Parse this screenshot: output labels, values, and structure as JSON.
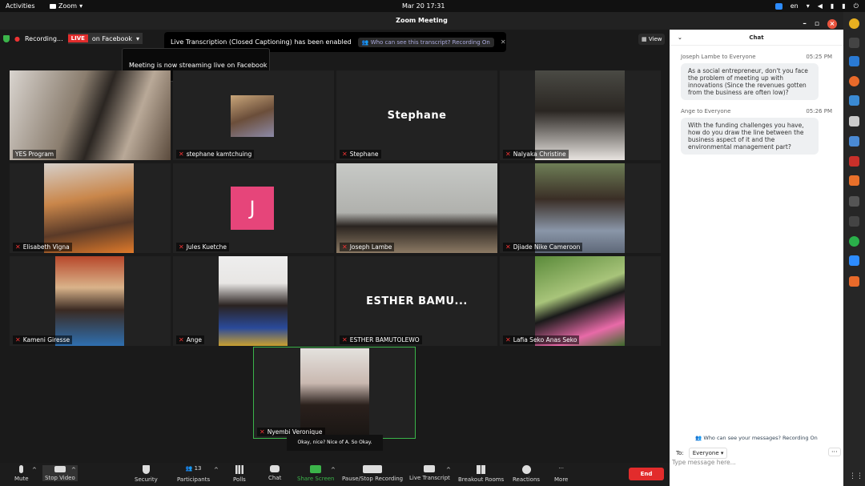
{
  "topbar": {
    "activities": "Activities",
    "app": "Zoom",
    "clock": "Mar 20  17:31",
    "lang": "en"
  },
  "window": {
    "title": "Zoom Meeting"
  },
  "meeting": {
    "recording": "Recording...",
    "live_badge": "LIVE",
    "live_target": "on Facebook",
    "transcription_notice": "Live Transcription (Closed Captioning) has been enabled",
    "transcript_link": "Who can see this transcript? Recording On",
    "tooltip": "Meeting is now streaming live on Facebook",
    "view_label": "View",
    "caption": "Okay, nice? Nice of A. So Okay.",
    "tiles": [
      {
        "name": "YES Program",
        "bigname": "",
        "avatar_letter": ""
      },
      {
        "name": "stephane kamtchuing",
        "bigname": "",
        "avatar_letter": ""
      },
      {
        "name": "Stephane",
        "bigname": "Stephane",
        "avatar_letter": ""
      },
      {
        "name": "Nalyaka Christine",
        "bigname": "",
        "avatar_letter": ""
      },
      {
        "name": "Elisabeth Vigna",
        "bigname": "",
        "avatar_letter": ""
      },
      {
        "name": "Jules Kuetche",
        "bigname": "",
        "avatar_letter": "J"
      },
      {
        "name": "Joseph Lambe",
        "bigname": "",
        "avatar_letter": ""
      },
      {
        "name": "Djiade Nike Cameroon",
        "bigname": "",
        "avatar_letter": ""
      },
      {
        "name": "Kameni Giresse",
        "bigname": "",
        "avatar_letter": ""
      },
      {
        "name": "Ange",
        "bigname": "",
        "avatar_letter": ""
      },
      {
        "name": "ESTHER BAMUTOLEWO",
        "bigname": "ESTHER BAMU...",
        "avatar_letter": ""
      },
      {
        "name": "Lafia Seko Anas Seko",
        "bigname": "",
        "avatar_letter": ""
      },
      {
        "name": "Nyembi Veronique",
        "bigname": "",
        "avatar_letter": ""
      }
    ]
  },
  "toolbar": {
    "mute": "Mute",
    "stop_video": "Stop Video",
    "security": "Security",
    "participants": "Participants",
    "participants_count": "13",
    "polls": "Polls",
    "chat": "Chat",
    "share": "Share Screen",
    "record": "Pause/Stop Recording",
    "transcript": "Live Transcript",
    "breakout": "Breakout Rooms",
    "reactions": "Reactions",
    "more": "More",
    "end": "End"
  },
  "chat": {
    "title": "Chat",
    "messages": [
      {
        "from": "Joseph Lambe to Everyone",
        "time": "05:25 PM",
        "text": "As a social entrepreneur, don't you face the problem of meeting up with innovations (Since the revenues gotten from the business are often low)?"
      },
      {
        "from": "Ange to Everyone",
        "time": "05:26 PM",
        "text": "With the funding challenges you have, how do you draw the line between the business aspect of it and the environmental management part?"
      }
    ],
    "who_can_see": "Who can see your messages? Recording On",
    "to_label": "To:",
    "to_value": "Everyone",
    "placeholder": "Type message here..."
  },
  "colors": {
    "live": "#e22c2c",
    "share": "#3bb44a",
    "end": "#e22c2c",
    "active_speaker": "#3bb44a"
  }
}
